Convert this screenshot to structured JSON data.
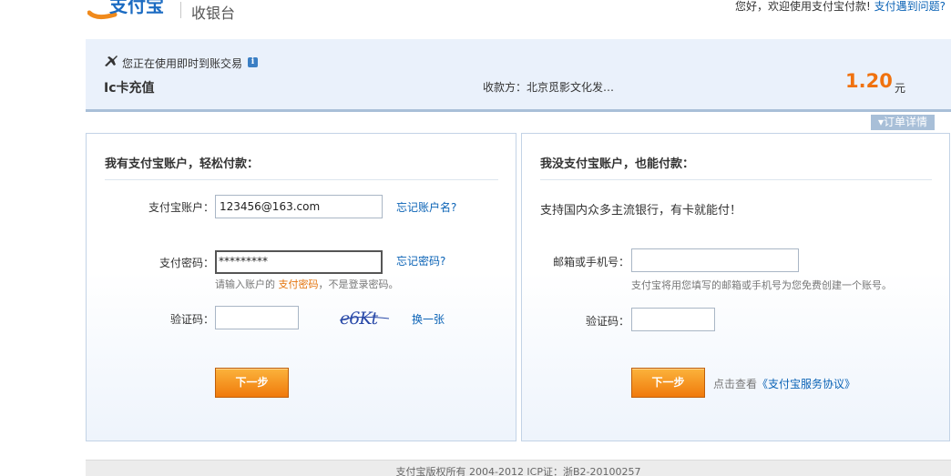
{
  "header": {
    "logo_alt": "支付宝",
    "subtitle": "收银台",
    "greeting": "您好，欢迎使用支付宝付款!",
    "help_link": "支付遇到问题?"
  },
  "order": {
    "mode_text": "您正在使用即时到账交易",
    "info_icon": "i",
    "title": "Ic卡充值",
    "payee": "收款方：北京觅影文化发…",
    "amount": "1.20",
    "unit": "元",
    "detail_tab": "订单详情"
  },
  "login_card": {
    "title": "我有支付宝账户，轻松付款：",
    "account_label": "支付宝账户：",
    "account_value": "123456@163.com",
    "forgot_account": "忘记账户名?",
    "password_label": "支付密码：",
    "password_value": "*********",
    "forgot_password": "忘记密码?",
    "hint_prefix": "请输入账户的",
    "hint_highlight": "支付密码",
    "hint_suffix": "，不是登录密码。",
    "captcha_label": "验证码：",
    "captcha_text": "e6Kt",
    "refresh_captcha": "换一张",
    "next_button": "下一步"
  },
  "guest_card": {
    "title": "我没支付宝账户，也能付款：",
    "intro": "支持国内众多主流银行，有卡就能付！",
    "contact_label": "邮箱或手机号：",
    "contact_hint": "支付宝将用您填写的邮箱或手机号为您免费创建一个账号。",
    "captcha_label": "验证码：",
    "next_button": "下一步",
    "agreement_prefix": "点击查看",
    "agreement_link": "《支付宝服务协议》"
  },
  "footer": {
    "text": "支付宝版权所有 2004-2012 ICP证：浙B2-20100257"
  },
  "colors": {
    "accent_orange": "#f0720f",
    "link_blue": "#0b63b6",
    "panel_bg": "#eaf1fb",
    "border_blue": "#c3d3e6"
  },
  "icons": {
    "logo": "alipay-logo",
    "mode": "plane-icon",
    "info": "info-icon",
    "dropdown": "triangle-down-icon"
  }
}
